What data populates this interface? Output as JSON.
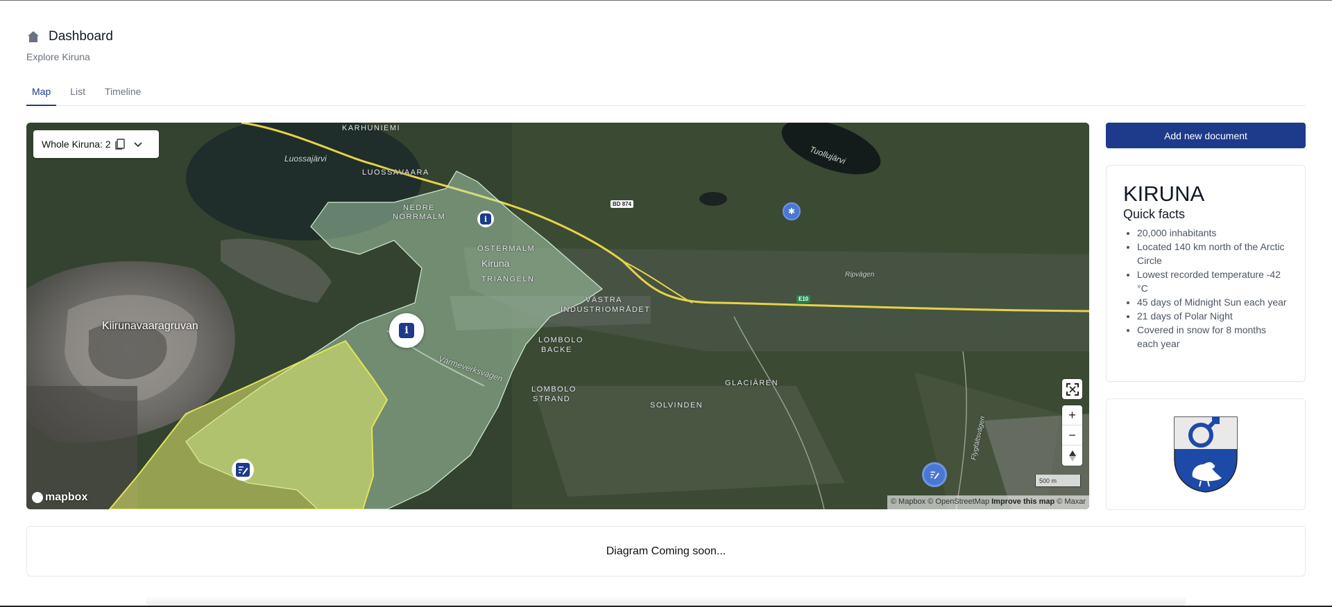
{
  "header": {
    "title": "Dashboard",
    "subtitle": "Explore Kiruna",
    "icon": "home-icon"
  },
  "tabs": [
    {
      "label": "Map",
      "active": true
    },
    {
      "label": "List",
      "active": false
    },
    {
      "label": "Timeline",
      "active": false
    }
  ],
  "map": {
    "area_select": "Whole Kiruna: 2",
    "labels": {
      "karhuniemi": "KARHUNIEMI",
      "luossajarvi": "Luossajärvi",
      "luossavaara": "LUOSSAVAARA",
      "nedre_normalm_1": "NEDRE",
      "nedre_normalm_2": "NORRMALM",
      "ostermalm": "ÖSTERMALM",
      "kiruna": "Kiruna",
      "triangeln": "TRIANGELN",
      "vastra_1": "VÄSTRA",
      "vastra_2": "INDUSTRIOMRÅDET",
      "lombolo_backe_1": "LOMBOLO",
      "lombolo_backe_2": "BACKE",
      "lombolo_strand_1": "LOMBOLO",
      "lombolo_strand_2": "STRAND",
      "solvinden": "SOLVINDEN",
      "glaciaren": "GLACIÄREN",
      "varmeverksvagen": "Värmeverksvägen",
      "kiirunavaaragruvan": "Kiirunavaaragruvan",
      "tuolluvarvi": "Tuollujärvi",
      "ripvagen": "Ripvägen",
      "flygfaltsvagen": "Flygfältsvägen",
      "bd874": "BD 874",
      "e10": "E10"
    },
    "controls": {
      "fullscreen": "⛶",
      "zoom_in": "+",
      "zoom_out": "−",
      "compass": "▲"
    },
    "scale": "500 m",
    "attribution": {
      "a": "© Mapbox © OpenStreetMap",
      "b": "Improve this map",
      "c": "© Maxar"
    },
    "logo": "mapbox"
  },
  "sidebar": {
    "add_button": "Add new document",
    "facts": {
      "title": "KIRUNA",
      "subtitle": "Quick facts",
      "items": [
        "20,000 inhabitants",
        "Located 140 km north of the Arctic Circle",
        "Lowest recorded temperature -42 °C",
        "45 days of Midnight Sun each year",
        "21 days of Polar Night",
        "Covered in snow for 8 months each year"
      ]
    }
  },
  "diagram": {
    "text": "Diagram Coming soon..."
  },
  "colors": {
    "primary": "#1e3a8a",
    "marker_blue": "#4a77d4"
  }
}
